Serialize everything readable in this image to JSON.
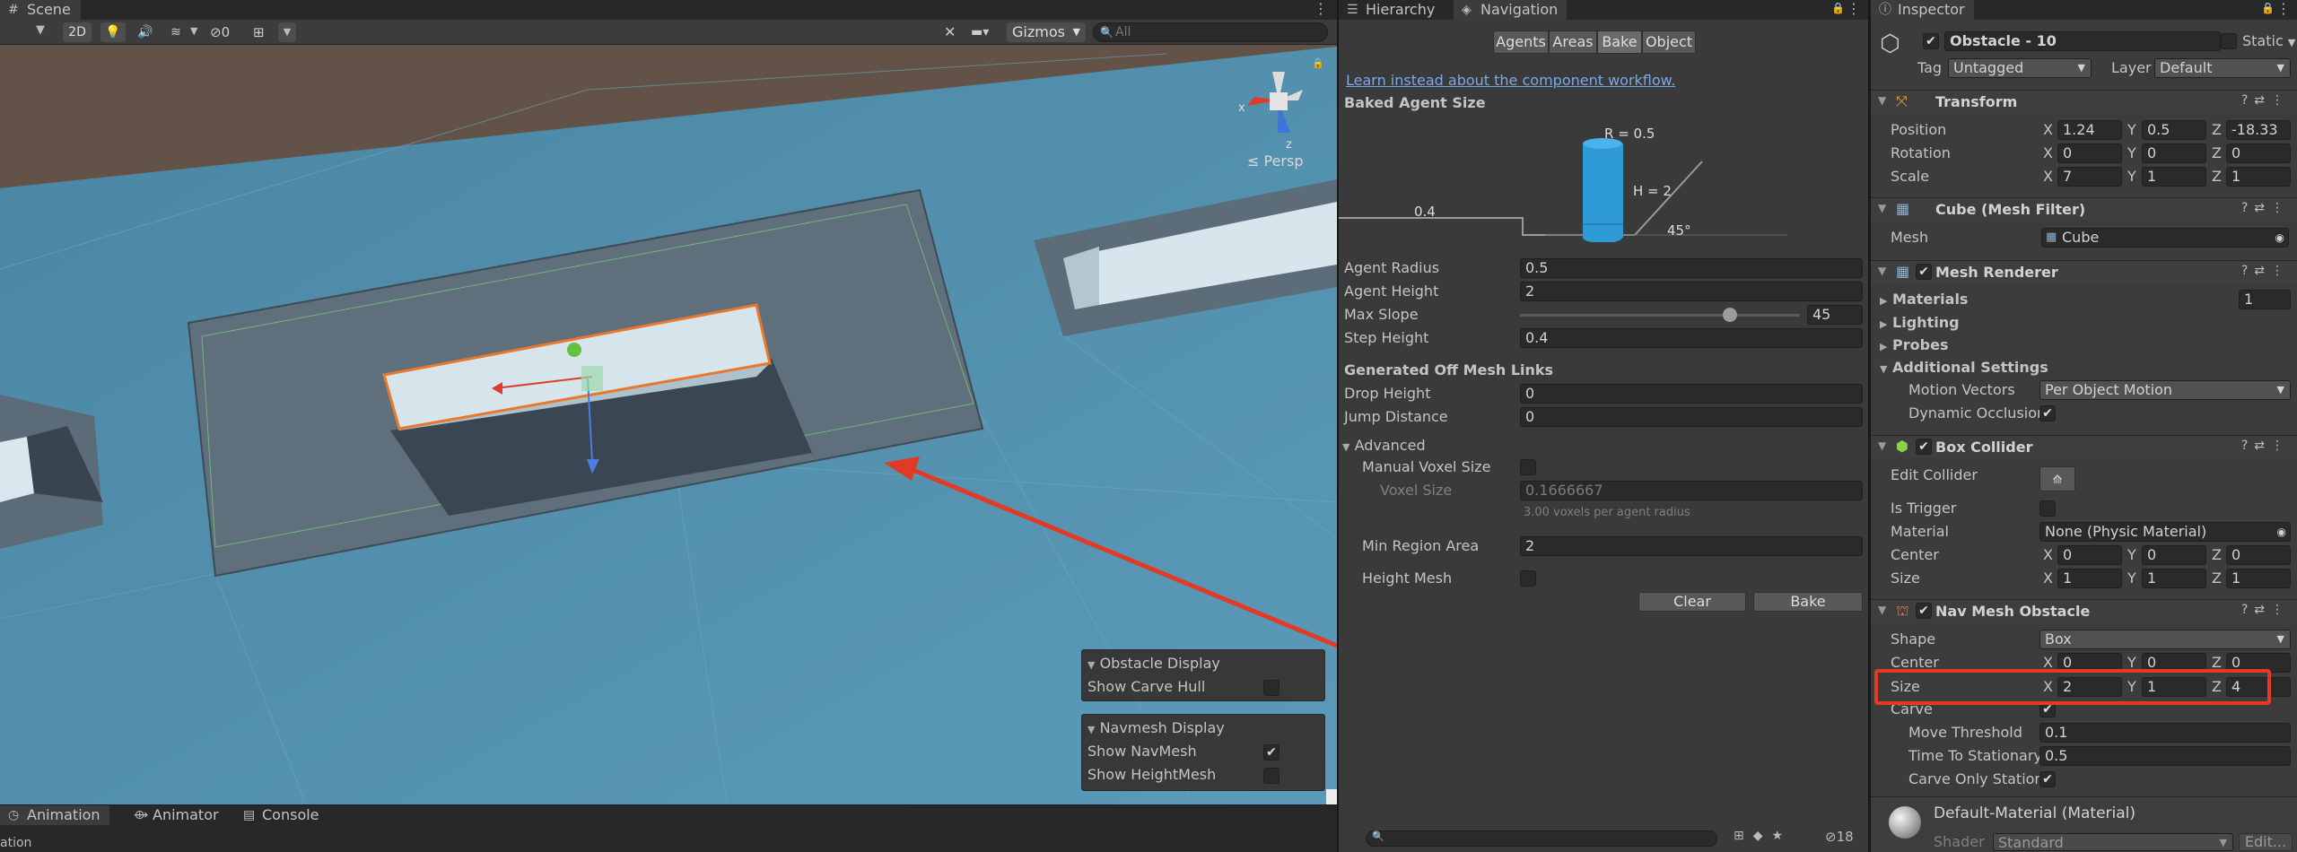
{
  "scene": {
    "tab": "Scene",
    "mode_2d": "2D",
    "hidden_count": "0",
    "gizmos": "Gizmos",
    "search_placeholder": "All",
    "persp": "≤ Persp",
    "overlay_obstacle": {
      "title": "Obstacle Display",
      "show_carve_hull": "Show Carve Hull",
      "carve_hull_checked": false
    },
    "overlay_navmesh": {
      "title": "Navmesh Display",
      "show_navmesh": "Show NavMesh",
      "show_navmesh_checked": true,
      "show_heightmesh": "Show HeightMesh",
      "show_heightmesh_checked": false
    },
    "colors": {
      "ground": "#4e8aa6",
      "platform": "#5f6f7c",
      "cube": "#d8e6ee",
      "highlight": "#e04a2a"
    }
  },
  "bottom": {
    "tabs": [
      "Animation",
      "Animator",
      "Console"
    ],
    "status_text": "ation",
    "layer_count": "18"
  },
  "navigation": {
    "tabs": [
      "Hierarchy",
      "Navigation"
    ],
    "subtabs": [
      "Agents",
      "Areas",
      "Bake",
      "Object"
    ],
    "active_subtab": "Bake",
    "link": "Learn instead about the component workflow.",
    "baked_agent_size": "Baked Agent Size",
    "diagram": {
      "r": "R = 0.5",
      "h": "H = 2",
      "step": "0.4",
      "slope": "45°"
    },
    "fields": [
      {
        "label": "Agent Radius",
        "value": "0.5"
      },
      {
        "label": "Agent Height",
        "value": "2"
      },
      {
        "label": "Max Slope",
        "value": "45",
        "slider_fraction": 0.75
      },
      {
        "label": "Step Height",
        "value": "0.4"
      }
    ],
    "offmesh_title": "Generated Off Mesh Links",
    "offmesh_fields": [
      {
        "label": "Drop Height",
        "value": "0"
      },
      {
        "label": "Jump Distance",
        "value": "0"
      }
    ],
    "advanced": "Advanced",
    "manual_voxel": "Manual Voxel Size",
    "voxel_size": "Voxel Size",
    "voxel_size_value": "0.1666667",
    "voxel_hint": "3.00 voxels per agent radius",
    "min_region": "Min Region Area",
    "min_region_value": "2",
    "height_mesh": "Height Mesh",
    "clear": "Clear",
    "bake": "Bake"
  },
  "inspector": {
    "tab": "Inspector",
    "name": "Obstacle - 10",
    "static": "Static",
    "tag_label": "Tag",
    "tag": "Untagged",
    "layer_label": "Layer",
    "layer": "Default",
    "transform": {
      "title": "Transform",
      "rows": [
        {
          "label": "Position",
          "x": "1.24",
          "y": "0.5",
          "z": "-18.33"
        },
        {
          "label": "Rotation",
          "x": "0",
          "y": "0",
          "z": "0"
        },
        {
          "label": "Scale",
          "x": "7",
          "y": "1",
          "z": "1"
        }
      ]
    },
    "mesh_filter": {
      "title": "Cube (Mesh Filter)",
      "mesh_label": "Mesh",
      "mesh": "Cube"
    },
    "mesh_renderer": {
      "title": "Mesh Renderer",
      "materials": "Materials",
      "materials_count": "1",
      "lighting": "Lighting",
      "probes": "Probes",
      "additional": "Additional Settings",
      "motion_vectors": "Motion Vectors",
      "motion_vectors_value": "Per Object Motion",
      "dynamic_occlusion": "Dynamic Occlusion"
    },
    "box_collider": {
      "title": "Box Collider",
      "edit_collider": "Edit Collider",
      "is_trigger": "Is Trigger",
      "material": "Material",
      "material_value": "None (Physic Material)",
      "center": {
        "label": "Center",
        "x": "0",
        "y": "0",
        "z": "0"
      },
      "size": {
        "label": "Size",
        "x": "1",
        "y": "1",
        "z": "1"
      }
    },
    "nav_obstacle": {
      "title": "Nav Mesh Obstacle",
      "shape": "Shape",
      "shape_value": "Box",
      "center": {
        "label": "Center",
        "x": "0",
        "y": "0",
        "z": "0"
      },
      "size": {
        "label": "Size",
        "x": "2",
        "y": "1",
        "z": "4"
      },
      "carve": "Carve",
      "move_threshold": "Move Threshold",
      "move_threshold_value": "0.1",
      "time_to_stationary": "Time To Stationary",
      "time_to_stationary_value": "0.5",
      "carve_only_stationary": "Carve Only Stationa"
    },
    "material": {
      "name": "Default-Material (Material)",
      "shader_label": "Shader",
      "shader": "Standard",
      "edit": "Edit..."
    }
  }
}
